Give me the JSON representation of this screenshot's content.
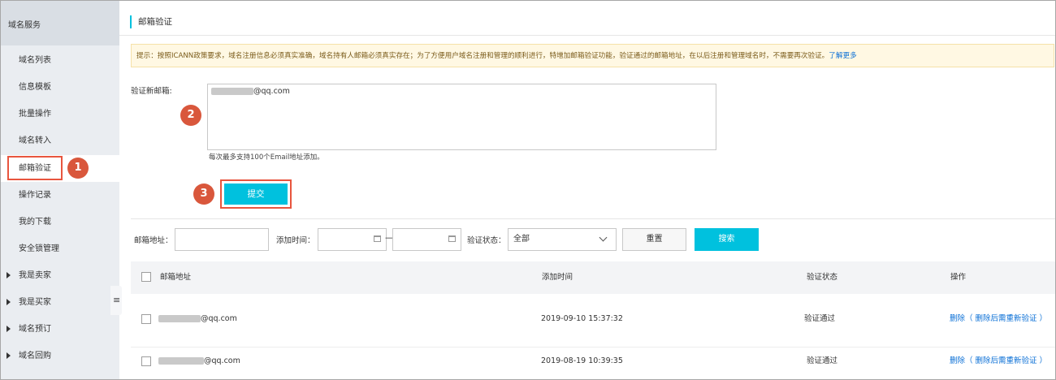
{
  "sidebar": {
    "header": "域名服务",
    "items": [
      {
        "label": "域名列表"
      },
      {
        "label": "信息模板"
      },
      {
        "label": "批量操作"
      },
      {
        "label": "域名转入"
      },
      {
        "label": "邮箱验证"
      },
      {
        "label": "操作记录"
      },
      {
        "label": "我的下载"
      },
      {
        "label": "安全锁管理"
      }
    ],
    "groups": [
      {
        "label": "我是卖家"
      },
      {
        "label": "我是买家"
      },
      {
        "label": "域名预订"
      },
      {
        "label": "域名回购"
      }
    ],
    "collapse_icon": "≡"
  },
  "page": {
    "title": "邮箱验证",
    "notice_text": "提示：按照ICANN政策要求，域名注册信息必须真实准确，域名持有人邮箱必须真实存在；为了方便用户域名注册和管理的顺利进行，特增加邮箱验证功能，验证通过的邮箱地址，在以后注册和管理域名时，不需要再次验证。",
    "notice_link": "了解更多",
    "new_email_label": "验证新邮箱:",
    "email_value": "@qq.com",
    "hint": "每次最多支持100个Email地址添加。",
    "submit_label": "提交"
  },
  "steps": [
    "1",
    "2",
    "3"
  ],
  "filter": {
    "email_label": "邮箱地址：",
    "email_value": "",
    "time_label": "添加时间：",
    "time_from": "",
    "time_to": "",
    "dash": "—",
    "status_label": "验证状态：",
    "status_value": "全部",
    "reset_label": "重置",
    "search_label": "搜索"
  },
  "table": {
    "headers": [
      "邮箱地址",
      "添加时间",
      "验证状态",
      "操作"
    ],
    "rows": [
      {
        "email": "@qq.com",
        "time": "2019-09-10 15:37:32",
        "status": "验证通过",
        "action": "删除（ 删除后需重新验证 ）"
      },
      {
        "email": "@qq.com",
        "time": "2019-08-19 10:39:35",
        "status": "验证通过",
        "action": "删除（ 删除后需重新验证 ）"
      }
    ]
  },
  "colors": {
    "accent": "#00c1de",
    "highlight": "#e8553e",
    "link": "#0a6fd6"
  }
}
